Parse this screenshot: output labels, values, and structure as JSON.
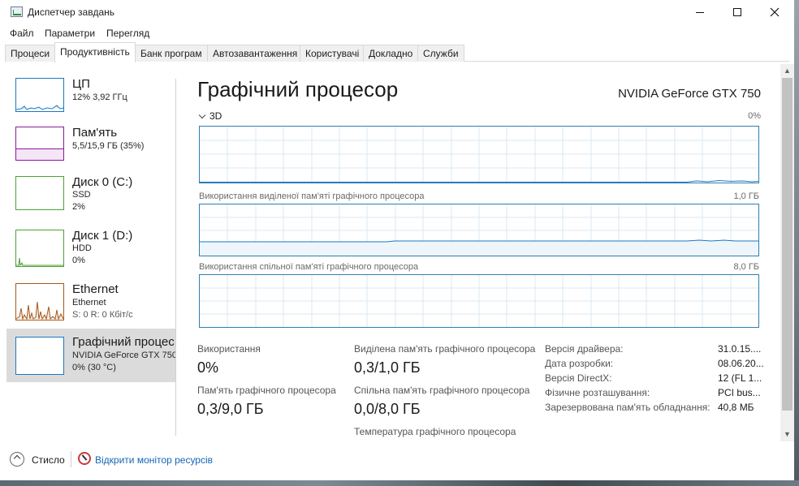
{
  "window": {
    "title": "Диспетчер завдань",
    "controls": {
      "minimize": "minimize-icon",
      "maximize": "maximize-icon",
      "close": "close-icon"
    }
  },
  "menu": [
    "Файл",
    "Параметри",
    "Перегляд"
  ],
  "tabs": [
    "Процеси",
    "Продуктивність",
    "Банк програм",
    "Автозавантаження",
    "Користувачі",
    "Докладно",
    "Служби"
  ],
  "active_tab": "Продуктивність",
  "sidebar": [
    {
      "title": "ЦП",
      "sub1": "12%  3,92 ГГц",
      "sub2": "",
      "accent": "#1d77c2"
    },
    {
      "title": "Пам'ять",
      "sub1": "5,5/15,9 ГБ (35%)",
      "sub2": "",
      "accent": "#8b1a9a"
    },
    {
      "title": "Диск 0 (C:)",
      "sub1": "SSD",
      "sub2": "2%",
      "accent": "#4da136"
    },
    {
      "title": "Диск 1 (D:)",
      "sub1": "HDD",
      "sub2": "0%",
      "accent": "#4da136"
    },
    {
      "title": "Ethernet",
      "sub1": "Ethernet",
      "sub2": "S: 0  R: 0 Кбіт/с",
      "accent": "#a7581a"
    },
    {
      "title": "Графічний процес",
      "sub1": "NVIDIA GeForce GTX 750",
      "sub2": "0%  (30 °C)",
      "accent": "#1d77c2",
      "selected": true
    }
  ],
  "main": {
    "title": "Графічний процесор",
    "gpu_name": "NVIDIA GeForce GTX 750",
    "engine_label": "3D",
    "engine_max": "0%",
    "dedicated_label": "Використання виділеної пам'яті графічного процесора",
    "dedicated_max": "1,0 ГБ",
    "shared_label": "Використання спільної пам'яті графічного процесора",
    "shared_max": "8,0 ГБ",
    "graph_color": "#1d77c2"
  },
  "stats": {
    "usage_label": "Використання",
    "usage_value": "0%",
    "gpu_memory_label": "Пам'ять графічного процесора",
    "gpu_memory_value": "0,3/9,0 ГБ",
    "dedicated_label": "Виділена пам'ять графічного процесора",
    "dedicated_value": "0,3/1,0 ГБ",
    "shared_label": "Спільна пам'ять графічного процесора",
    "shared_value": "0,0/8,0 ГБ",
    "temperature_label": "Температура графічного процесора"
  },
  "details": [
    {
      "key": "Версія драйвера:",
      "value": "31.0.15...."
    },
    {
      "key": "Дата розробки:",
      "value": "08.06.20..."
    },
    {
      "key": "Версія DirectX:",
      "value": "12 (FL 1..."
    },
    {
      "key": "Фізичне розташування:",
      "value": "PCI bus..."
    },
    {
      "key": "Зарезервована пам'ять обладнання:",
      "value": "40,8 МБ"
    }
  ],
  "footer": {
    "fewer_details": "Стисло",
    "resource_monitor": "Відкрити монітор ресурсів"
  }
}
